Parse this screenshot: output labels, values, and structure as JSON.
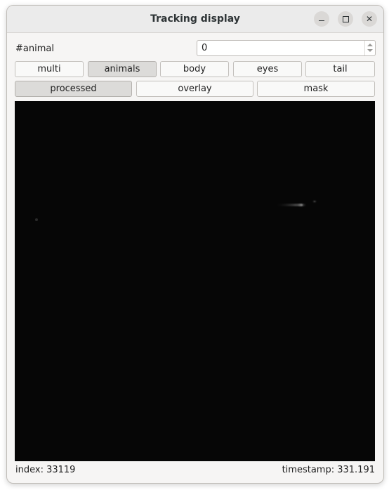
{
  "window": {
    "title": "Tracking display",
    "controls": [
      "minimize-icon",
      "maximize-icon",
      "close-icon"
    ]
  },
  "animal_selector": {
    "label": "#animal",
    "value": "0"
  },
  "display_modes": [
    {
      "label": "multi",
      "checked": false
    },
    {
      "label": "animals",
      "checked": true
    },
    {
      "label": "body",
      "checked": false
    },
    {
      "label": "eyes",
      "checked": false
    },
    {
      "label": "tail",
      "checked": false
    }
  ],
  "image_modes": [
    {
      "label": "processed",
      "checked": true
    },
    {
      "label": "overlay",
      "checked": false
    },
    {
      "label": "mask",
      "checked": false
    }
  ],
  "image": {
    "background_color": "#060606"
  },
  "status": {
    "index_label": "index:",
    "index_value": "33119",
    "timestamp_label": "timestamp:",
    "timestamp_value": "331.191"
  }
}
